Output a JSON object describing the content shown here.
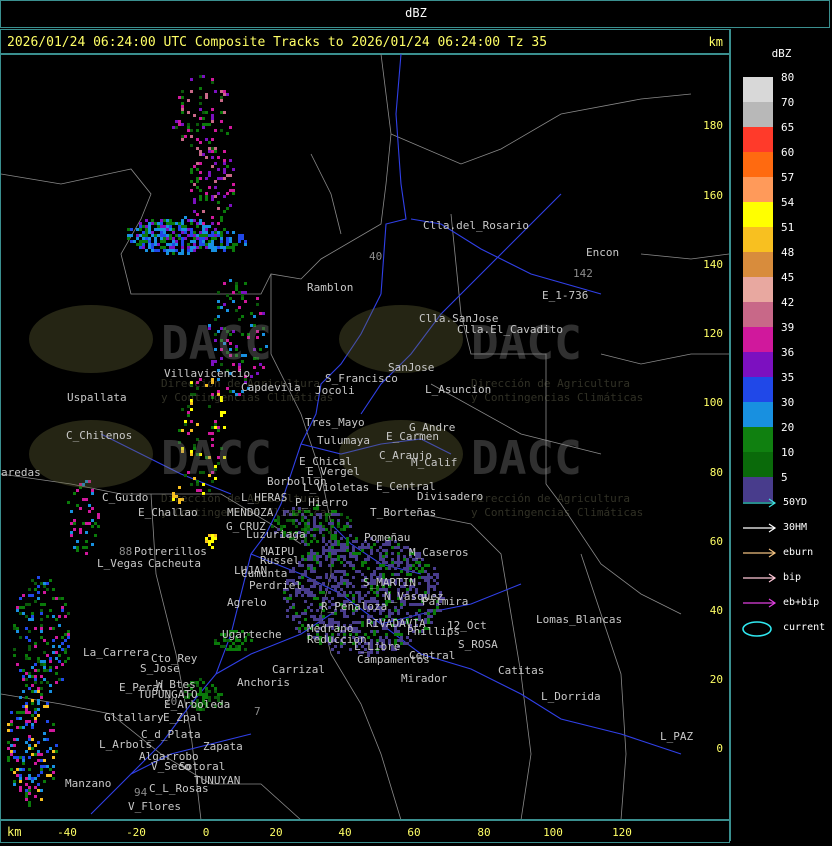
{
  "window": {
    "title": "dBZ"
  },
  "header": {
    "text": "2026/01/24 06:24:00 UTC Composite Tracks to 2026/01/24 06:24:00 Tz 35",
    "unit": "km"
  },
  "axes": {
    "x_unit": "km",
    "x_ticks": [
      "-40",
      "-20",
      "0",
      "20",
      "40",
      "60",
      "80",
      "100",
      "120"
    ],
    "y_ticks": [
      "180",
      "160",
      "140",
      "120",
      "100",
      "80",
      "60",
      "40",
      "20",
      "0"
    ]
  },
  "legend": {
    "title": "dBZ",
    "scale": [
      {
        "label": "80",
        "color": "#d8d8d8"
      },
      {
        "label": "70",
        "color": "#b8b8b8"
      },
      {
        "label": "65",
        "color": "#ff3a2a"
      },
      {
        "label": "60",
        "color": "#ff6a10"
      },
      {
        "label": "57",
        "color": "#ff9a5a"
      },
      {
        "label": "54",
        "color": "#ffff00"
      },
      {
        "label": "51",
        "color": "#f8c020"
      },
      {
        "label": "48",
        "color": "#d88c3c"
      },
      {
        "label": "45",
        "color": "#e8a8a0"
      },
      {
        "label": "42",
        "color": "#c86888"
      },
      {
        "label": "39",
        "color": "#d0189c"
      },
      {
        "label": "36",
        "color": "#7c10c0"
      },
      {
        "label": "35",
        "color": "#2048e8"
      },
      {
        "label": "30",
        "color": "#1890e0"
      },
      {
        "label": "20",
        "color": "#108010"
      },
      {
        "label": "10",
        "color": "#0a6a0a"
      },
      {
        "label": "5",
        "color": "#483c8c"
      }
    ],
    "tracks": [
      {
        "label": "50YD",
        "color": "#40e0e0"
      },
      {
        "label": "30HM",
        "color": "#ffffff"
      },
      {
        "label": "eburn",
        "color": "#f0c080"
      },
      {
        "label": "bip",
        "color": "#ffc8d8"
      },
      {
        "label": "eb+bip",
        "color": "#e040e0"
      }
    ],
    "current": {
      "label": "current",
      "color": "#30e8f0"
    }
  },
  "watermark": {
    "brand": "DACC",
    "line1": "Dirección de Agricultura",
    "line2": "y Contingencias Climáticas"
  },
  "places": [
    {
      "name": "Clla.del_Rosario",
      "color": "#c8c8c8"
    },
    {
      "name": "Encon",
      "color": "#c8c8c8"
    },
    {
      "name": "142",
      "color": "#8c8c8c"
    },
    {
      "name": "E_1-736",
      "color": "#c8c8c8"
    },
    {
      "name": "Ramblon",
      "color": "#c8c8c8"
    },
    {
      "name": "Clla.SanJose",
      "color": "#c8c8c8"
    },
    {
      "name": "Clla.El_Cavadito",
      "color": "#c8c8c8"
    },
    {
      "name": "Villavicencio",
      "color": "#c8c8c8"
    },
    {
      "name": "Capdevila",
      "color": "#c8c8c8"
    },
    {
      "name": "Jocoli",
      "color": "#c8c8c8"
    },
    {
      "name": "S_Francisco",
      "color": "#c8c8c8"
    },
    {
      "name": "SanJose",
      "color": "#c8c8c8"
    },
    {
      "name": "L_Asuncion",
      "color": "#c8c8c8"
    },
    {
      "name": "Uspallata",
      "color": "#c8c8c8"
    },
    {
      "name": "Tres_Mayo",
      "color": "#c8c8c8"
    },
    {
      "name": "G_Andre",
      "color": "#c8c8c8"
    },
    {
      "name": "E_Carmen",
      "color": "#c8c8c8"
    },
    {
      "name": "C_Chilenos",
      "color": "#c8c8c8"
    },
    {
      "name": "Tulumaya",
      "color": "#c8c8c8"
    },
    {
      "name": "C_Araujo",
      "color": "#c8c8c8"
    },
    {
      "name": "M_Calif",
      "color": "#c8c8c8"
    },
    {
      "name": "E_Chical",
      "color": "#c8c8c8"
    },
    {
      "name": "E_Vergel",
      "color": "#c8c8c8"
    },
    {
      "name": "aredas",
      "color": "#c8c8c8"
    },
    {
      "name": "Borbollon",
      "color": "#c8c8c8"
    },
    {
      "name": "L_Violetas",
      "color": "#c8c8c8"
    },
    {
      "name": "E_Central",
      "color": "#c8c8c8"
    },
    {
      "name": "Divisadero",
      "color": "#c8c8c8"
    },
    {
      "name": "C_Guido",
      "color": "#c8c8c8"
    },
    {
      "name": "L_HERAS",
      "color": "#c8c8c8"
    },
    {
      "name": "P_Hierro",
      "color": "#c8c8c8"
    },
    {
      "name": "E_Challao",
      "color": "#c8c8c8"
    },
    {
      "name": "MENDOZA",
      "color": "#c8c8c8"
    },
    {
      "name": "T_Borteñas",
      "color": "#c8c8c8"
    },
    {
      "name": "G_CRUZ",
      "color": "#c8c8c8"
    },
    {
      "name": "Luzuriaga",
      "color": "#c8c8c8"
    },
    {
      "name": "Pomeñau",
      "color": "#c8c8c8"
    },
    {
      "name": "88",
      "color": "#8c8c8c"
    },
    {
      "name": "Potrerillos",
      "color": "#c8c8c8"
    },
    {
      "name": "MAIPU",
      "color": "#c8c8c8"
    },
    {
      "name": "M_Caseros",
      "color": "#c8c8c8"
    },
    {
      "name": "L_Vegas",
      "color": "#c8c8c8"
    },
    {
      "name": "Cacheuta",
      "color": "#c8c8c8"
    },
    {
      "name": "Russel",
      "color": "#c8c8c8"
    },
    {
      "name": "LUJAN",
      "color": "#c8c8c8"
    },
    {
      "name": "Cumunta",
      "color": "#c8c8c8"
    },
    {
      "name": "Perdriel",
      "color": "#c8c8c8"
    },
    {
      "name": "S_MARTIN",
      "color": "#c8c8c8"
    },
    {
      "name": "N_Vasquez",
      "color": "#c8c8c8"
    },
    {
      "name": "Palmira",
      "color": "#c8c8c8"
    },
    {
      "name": "Agrelo",
      "color": "#c8c8c8"
    },
    {
      "name": "R_Peñaloza",
      "color": "#c8c8c8"
    },
    {
      "name": "Lomas_Blancas",
      "color": "#c8c8c8"
    },
    {
      "name": "Ugarteche",
      "color": "#c8c8c8"
    },
    {
      "name": "Medrano",
      "color": "#c8c8c8"
    },
    {
      "name": "RIVADAVIA",
      "color": "#c8c8c8"
    },
    {
      "name": "Phillips",
      "color": "#c8c8c8"
    },
    {
      "name": "12_Oct",
      "color": "#c8c8c8"
    },
    {
      "name": "Reduccion",
      "color": "#c8c8c8"
    },
    {
      "name": "S_ROSA",
      "color": "#c8c8c8"
    },
    {
      "name": "L_Libre",
      "color": "#c8c8c8"
    },
    {
      "name": "Central",
      "color": "#c8c8c8"
    },
    {
      "name": "La_Carrera",
      "color": "#c8c8c8"
    },
    {
      "name": "Cto_Rey",
      "color": "#c8c8c8"
    },
    {
      "name": "Campamentos",
      "color": "#c8c8c8"
    },
    {
      "name": "S_Jose",
      "color": "#c8c8c8"
    },
    {
      "name": "Carrizal",
      "color": "#c8c8c8"
    },
    {
      "name": "Catitas",
      "color": "#c8c8c8"
    },
    {
      "name": "Mirador",
      "color": "#c8c8c8"
    },
    {
      "name": "W_Btes",
      "color": "#c8c8c8"
    },
    {
      "name": "Anchoris",
      "color": "#c8c8c8"
    },
    {
      "name": "E_Peral",
      "color": "#c8c8c8"
    },
    {
      "name": "TUPUNGATO",
      "color": "#c8c8c8"
    },
    {
      "name": "L_Dorrida",
      "color": "#c8c8c8"
    },
    {
      "name": "E_Arboleda",
      "color": "#c8c8c8"
    },
    {
      "name": "Gltallary",
      "color": "#c8c8c8"
    },
    {
      "name": "E_Zpal",
      "color": "#c8c8c8"
    },
    {
      "name": "C_d_Plata",
      "color": "#c8c8c8"
    },
    {
      "name": "L_Arbols",
      "color": "#c8c8c8"
    },
    {
      "name": "Zapata",
      "color": "#c8c8c8"
    },
    {
      "name": "L_PAZ",
      "color": "#c8c8c8"
    },
    {
      "name": "Algarrobo",
      "color": "#c8c8c8"
    },
    {
      "name": "V_Seco",
      "color": "#c8c8c8"
    },
    {
      "name": "Sotoral",
      "color": "#c8c8c8"
    },
    {
      "name": "TUNUYAN",
      "color": "#c8c8c8"
    },
    {
      "name": "Manzano",
      "color": "#c8c8c8"
    },
    {
      "name": "C_L_Rosas",
      "color": "#c8c8c8"
    },
    {
      "name": "V_Flores",
      "color": "#c8c8c8"
    },
    {
      "name": "40",
      "color": "#8c8c8c"
    },
    {
      "name": "20",
      "color": "#8c8c8c"
    },
    {
      "name": "7",
      "color": "#8c8c8c"
    },
    {
      "name": "94",
      "color": "#8c8c8c"
    }
  ]
}
